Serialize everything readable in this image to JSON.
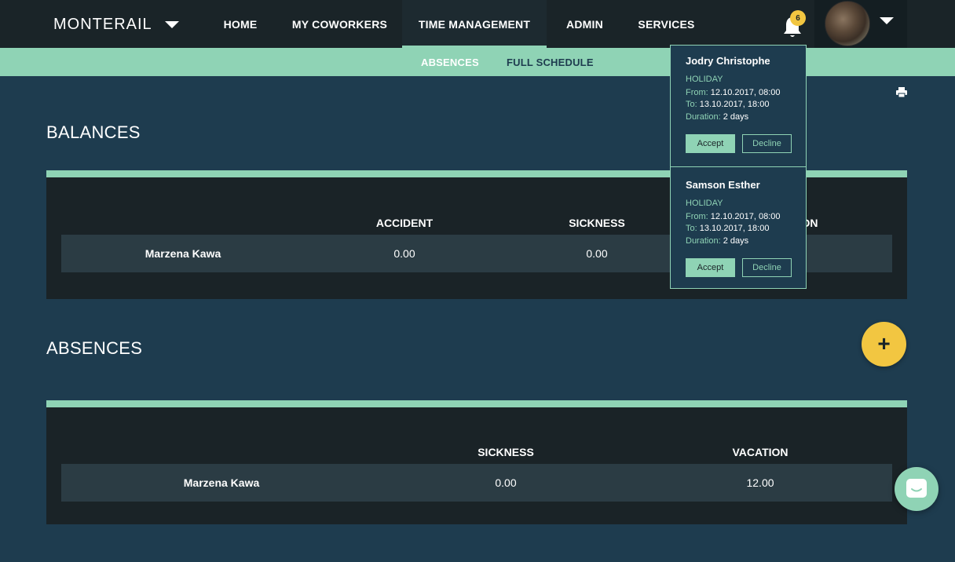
{
  "header": {
    "brand": "MONTERAIL",
    "nav": [
      "HOME",
      "MY COWORKERS",
      "TIME MANAGEMENT",
      "ADMIN",
      "SERVICES"
    ],
    "active_nav": "TIME MANAGEMENT",
    "notification_count": "6",
    "accent_color": "#8fd3b5",
    "badge_color": "#f2c641"
  },
  "subnav": {
    "items": [
      "ABSENCES",
      "FULL SCHEDULE"
    ],
    "active": "ABSENCES"
  },
  "balances": {
    "title": "BALANCES",
    "columns": [
      "ACCIDENT",
      "SICKNESS",
      "ON"
    ],
    "rows": [
      {
        "name": "Marzena Kawa",
        "accident": "0.00",
        "sickness": "0.00"
      }
    ]
  },
  "absences": {
    "title": "ABSENCES",
    "columns": [
      "SICKNESS",
      "VACATION"
    ],
    "rows": [
      {
        "name": "Marzena Kawa",
        "sickness": "0.00",
        "vacation": "12.00"
      }
    ]
  },
  "notifications": [
    {
      "name": "Jodry Christophe",
      "type": "HOLIDAY",
      "from_label": "From:",
      "from": "12.10.2017, 08:00",
      "to_label": "To:",
      "to": "13.10.2017, 18:00",
      "duration_label": "Duration:",
      "duration": "2 days",
      "accept": "Accept",
      "decline": "Decline"
    },
    {
      "name": "Samson Esther",
      "type": "HOLIDAY",
      "from_label": "From:",
      "from": "12.10.2017, 08:00",
      "to_label": "To:",
      "to": "13.10.2017, 18:00",
      "duration_label": "Duration:",
      "duration": "2 days",
      "accept": "Accept",
      "decline": "Decline"
    }
  ],
  "icons": {
    "print": "printer-icon",
    "bell": "bell-icon",
    "add": "plus-icon",
    "chat": "chat-icon"
  }
}
